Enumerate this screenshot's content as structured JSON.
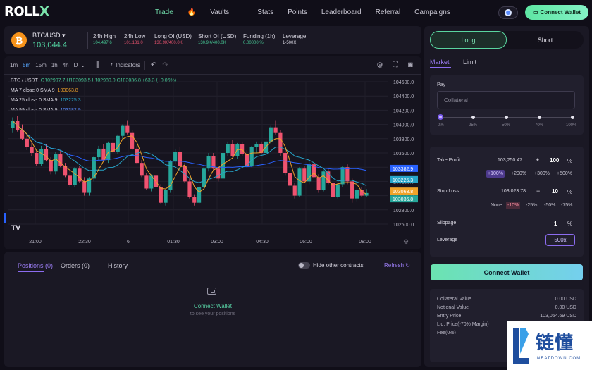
{
  "app": {
    "logo_main": "ROLL",
    "logo_x": "X",
    "nav": [
      "Trade",
      "Vaults",
      "Stats",
      "Points",
      "Leaderboard",
      "Referral",
      "Campaigns"
    ],
    "nav_active": "Trade",
    "connect_wallet": "Connect Wallet"
  },
  "ticker": {
    "pair": "BTC/USD",
    "price": "103,044.4",
    "stats": [
      {
        "label": "24h High",
        "value": "104,497.6",
        "color": "green"
      },
      {
        "label": "24h Low",
        "value": "101,131.0",
        "color": "red"
      },
      {
        "label": "Long OI (USD)",
        "value": "130.9K/400.0K",
        "color": "red"
      },
      {
        "label": "Short OI (USD)",
        "value": "130.9K/400.0K",
        "color": "green"
      },
      {
        "label": "Funding (1h)",
        "value": "0.00000 %",
        "color": "green"
      },
      {
        "label": "Leverage",
        "value": "1-500X",
        "color": "white"
      }
    ]
  },
  "toolbar": {
    "intervals": [
      "1m",
      "5m",
      "15m",
      "1h",
      "4h",
      "D"
    ],
    "active_interval": "5m",
    "indicators": "Indicators"
  },
  "legend": {
    "symbol": "BTC / USDT",
    "ohlc": "O102997.7 H103093.5 L102980.0 C103036.8 +63.3 (+0.06%)",
    "ma7_label": "MA 7 close 0 SMA 9",
    "ma7_value": "103063.8",
    "ma25_label": "MA 25 close 0 SMA 9",
    "ma25_value": "103225.3",
    "ma99_label": "MA 99 close 0 SMA 9",
    "ma99_value": "103382.9"
  },
  "chart_data": {
    "type": "candlestick",
    "y_ticks": [
      "104600.0",
      "104400.0",
      "104200.0",
      "104000.0",
      "103800.0",
      "103600.0",
      "103400.0",
      "103200.0",
      "103000.0",
      "102800.0",
      "102600.0"
    ],
    "ylim": [
      102600,
      104600
    ],
    "x_ticks": [
      "21:00",
      "22:30",
      "6",
      "01:30",
      "03:00",
      "04:30",
      "06:00",
      "08:00"
    ],
    "price_tags": [
      {
        "value": 103382.9,
        "label": "103382.9",
        "color": "#2962ff"
      },
      {
        "value": 103225.3,
        "label": "103225.3",
        "color": "#26a5c9"
      },
      {
        "value": 103063.8,
        "label": "103063.8",
        "color": "#f0a32a"
      },
      {
        "value": 103036.8,
        "label": "103036.8",
        "color": "#26a69a"
      }
    ],
    "candles": [
      [
        103950,
        104100,
        103880,
        104050
      ],
      [
        104050,
        104120,
        103900,
        103920
      ],
      [
        103920,
        104000,
        103780,
        103800
      ],
      [
        103800,
        103860,
        103640,
        103680
      ],
      [
        103680,
        103760,
        103560,
        103600
      ],
      [
        103600,
        103640,
        103420,
        103450
      ],
      [
        103450,
        103700,
        103420,
        103650
      ],
      [
        103650,
        103720,
        103480,
        103500
      ],
      [
        103500,
        103540,
        103300,
        103340
      ],
      [
        103340,
        103620,
        103300,
        103580
      ],
      [
        103580,
        103640,
        103400,
        103420
      ],
      [
        103420,
        103460,
        103260,
        103280
      ],
      [
        103280,
        103360,
        103120,
        103150
      ],
      [
        103150,
        103400,
        103120,
        103380
      ],
      [
        103380,
        103420,
        103180,
        103200
      ],
      [
        103200,
        103260,
        103000,
        103040
      ],
      [
        103040,
        103260,
        103000,
        103240
      ],
      [
        103240,
        103560,
        103200,
        103540
      ],
      [
        103540,
        103700,
        103500,
        103660
      ],
      [
        103660,
        103720,
        103480,
        103500
      ],
      [
        103500,
        103760,
        103460,
        103740
      ],
      [
        103740,
        103800,
        103600,
        103620
      ],
      [
        103620,
        103860,
        103580,
        103840
      ],
      [
        103840,
        104000,
        103800,
        103980
      ],
      [
        103980,
        104060,
        103860,
        103880
      ],
      [
        103880,
        103920,
        103640,
        103660
      ],
      [
        103660,
        103700,
        103440,
        103460
      ],
      [
        103460,
        103500,
        103260,
        103280
      ],
      [
        103280,
        103320,
        103080,
        103100
      ],
      [
        103100,
        103300,
        103060,
        103280
      ],
      [
        103280,
        103320,
        103100,
        103120
      ],
      [
        103120,
        103160,
        102880,
        102900
      ],
      [
        102900,
        103100,
        102860,
        103080
      ],
      [
        103080,
        103500,
        103040,
        103480
      ],
      [
        103480,
        103660,
        103440,
        103620
      ],
      [
        103620,
        103680,
        103400,
        103420
      ],
      [
        103420,
        103460,
        103180,
        103200
      ],
      [
        103200,
        103240,
        102960,
        102980
      ],
      [
        102980,
        103020,
        102860,
        102900
      ],
      [
        102900,
        103140,
        102880,
        103120
      ],
      [
        103120,
        103400,
        103100,
        103380
      ],
      [
        103380,
        103600,
        103340,
        103560
      ],
      [
        103560,
        103600,
        103360,
        103380
      ],
      [
        103380,
        103420,
        103200,
        103240
      ],
      [
        103240,
        103620,
        103220,
        103600
      ],
      [
        103600,
        103760,
        103560,
        103720
      ],
      [
        103720,
        103780,
        103540,
        103560
      ],
      [
        103560,
        103740,
        103520,
        103720
      ],
      [
        103720,
        103760,
        103560,
        103580
      ],
      [
        103580,
        103640,
        103400,
        103420
      ],
      [
        103420,
        103700,
        103400,
        103680
      ],
      [
        103680,
        103760,
        103600,
        103720
      ],
      [
        103720,
        103760,
        103580,
        103600
      ],
      [
        103600,
        103780,
        103560,
        103760
      ],
      [
        103760,
        103980,
        103720,
        103960
      ],
      [
        103960,
        104060,
        103860,
        103880
      ],
      [
        103880,
        103920,
        103560,
        103600
      ],
      [
        103600,
        103640,
        103280,
        103320
      ],
      [
        103320,
        103360,
        103100,
        103140
      ],
      [
        103140,
        103180,
        102960,
        103000
      ],
      [
        103000,
        103400,
        102980,
        103380
      ],
      [
        103380,
        103420,
        103180,
        103200
      ],
      [
        103200,
        103480,
        103160,
        103440
      ],
      [
        103440,
        103480,
        103240,
        103260
      ],
      [
        103260,
        103300,
        103040,
        103080
      ],
      [
        103080,
        103360,
        103060,
        103340
      ],
      [
        103340,
        103380,
        103160,
        103180
      ],
      [
        103180,
        103220,
        102940,
        102980
      ],
      [
        102980,
        103180,
        102960,
        103160
      ],
      [
        103160,
        103420,
        103120,
        103400
      ],
      [
        103400,
        103440,
        103160,
        103200
      ],
      [
        103200,
        103240,
        102900,
        102960
      ],
      [
        102960,
        103100,
        102920,
        103080
      ],
      [
        103080,
        103120,
        102980,
        103000
      ],
      [
        103000,
        103093,
        102980,
        103037
      ]
    ]
  },
  "positions": {
    "tabs": [
      "Positions (0)",
      "Orders (0)",
      "History"
    ],
    "hide_other": "Hide other contracts",
    "refresh": "Refresh",
    "connect": "Connect Wallet",
    "connect_sub": "to see your positions"
  },
  "trade": {
    "long": "Long",
    "short": "Short",
    "market": "Market",
    "limit": "Limit",
    "pay": "Pay",
    "collateral_placeholder": "Collateral",
    "slider_pcts": [
      "0%",
      "25%",
      "50%",
      "70%",
      "100%"
    ],
    "take_profit": "Take Profit",
    "tp_price": "103,250.47",
    "tp_value": "100",
    "tp_chips": [
      "+100%",
      "+200%",
      "+300%",
      "+500%"
    ],
    "stop_loss": "Stop Loss",
    "sl_price": "103,023.78",
    "sl_value": "10",
    "sl_chips": [
      "None",
      "-10%",
      "-25%",
      "-50%",
      "-75%"
    ],
    "slippage": "Slippage",
    "slippage_value": "1",
    "leverage": "Leverage",
    "leverage_value": "500x",
    "connect": "Connect Wallet",
    "info": [
      {
        "label": "Collateral Value",
        "value": "0.00 USD"
      },
      {
        "label": "Notional Value",
        "value": "0.00 USD"
      },
      {
        "label": "Entry Price",
        "value": "103,054.69 USD"
      },
      {
        "label": "Liq. Price(-70% Margin)",
        "value": ""
      },
      {
        "label": "Fee(0%)",
        "value": ""
      }
    ]
  },
  "watermark": {
    "text": "链懂",
    "sub": "NEATDOWN.COM"
  }
}
